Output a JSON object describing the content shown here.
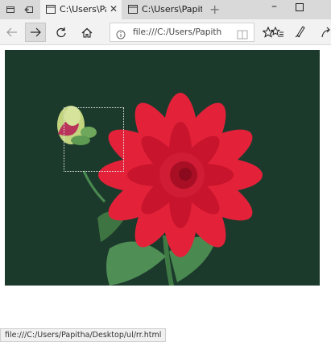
{
  "tabs": [
    {
      "title": "C:\\Users\\Papi",
      "active": true
    },
    {
      "title": "C:\\Users\\Papith",
      "active": false
    }
  ],
  "address_bar": {
    "url": "file:///C:/Users/Papith"
  },
  "status_bar": {
    "text": "file:///C:/Users/Papitha/Desktop/ul/rr.html"
  },
  "icons": [
    "tab-manager-icon",
    "set-aside-tabs-icon",
    "page-icon",
    "close-icon",
    "new-tab-icon",
    "minimize-icon",
    "maximize-icon",
    "back-icon",
    "forward-icon",
    "refresh-icon",
    "home-icon",
    "info-icon",
    "reading-view-icon",
    "favorite-star-icon",
    "favorites-hub-icon",
    "web-note-pen-icon",
    "share-icon"
  ],
  "colors": {
    "photo_background": "#1c3a2c",
    "petal_red": "#e3223a",
    "leaf_green": "#4f8f55"
  }
}
